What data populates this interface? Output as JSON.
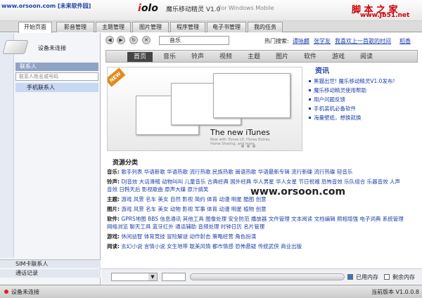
{
  "titlebar": {
    "site_url": "www.orsoon.com [未来软件园]",
    "logo_i": "i",
    "logo_olo": "olo",
    "app_name": "魔乐移动精灵 V1.0",
    "platform": "For Windows Mobile",
    "site_logo": "脚 本 之 家",
    "site_sub": "www.Jb51.net"
  },
  "tabs": [
    "开始页面",
    "影音管理",
    "主题管理",
    "图片管理",
    "程序管理",
    "电子书管理",
    "我的任务"
  ],
  "left": {
    "device_status": "设备未连接",
    "contacts_header": "联系人",
    "search_placeholder": "联系人姓名或号码",
    "contacts_item": "手机联系人",
    "bottom_sim": "SIM卡联系人",
    "bottom_calls": "通话记录"
  },
  "nav": {
    "back": "◀",
    "forward": "▶",
    "refresh": "↻",
    "stop": "✕",
    "address": "音乐",
    "hot_label": "热门搜索:",
    "hot_links": [
      "谭咏麟",
      "张学友",
      "我喜欢上一首歌的时间",
      "稻香"
    ]
  },
  "categories": [
    "首页",
    "音乐",
    "铃声",
    "视频",
    "主题",
    "图片",
    "软件",
    "游戏",
    "阅读"
  ],
  "banner": {
    "badge": "NEW",
    "headline": "The new iTunes",
    "sub": "Now with iTunes LP, iTunes Extras, Home Sharing, and more."
  },
  "info": {
    "title": "资讯",
    "items": [
      "黑猫出世! 魔乐移动精灵V1.0发布!",
      "魔乐移动精灵使用帮助",
      "用户问题反馈",
      "手机装机必备软件",
      "海量壁纸，想换就换"
    ]
  },
  "resources": {
    "title": "资源分类",
    "rows": [
      {
        "label": "音乐:",
        "links": "歌手列表 华语新歌 华语热歌 流行热歌 民族热歌 闽语热歌 华语最新专辑 流行新碟 流行热碟 轻音乐"
      },
      {
        "label": "铃声:",
        "links": "DJ音效 大话滑稽 动物叫叫 儿童音乐 古典经典 国外经典 华人男星 华人女星 节日祝福 恐怖音效 乐队组合 乐器音效 人声音效 日韩天后 影视歌曲 原声大碟 原汁搞笑"
      },
      {
        "label": "主题:",
        "links": "游戏 风景 名车 美女 自然 影视 简约 体育 动漫 明星 酷图 创意"
      },
      {
        "label": "图片:",
        "links": "游戏 风景 名车 美女 动物 影视 军事 体育 动漫 明星 植物 创意"
      },
      {
        "label": "软件:",
        "links": "GPRS地图 BBS 信息通讯 其他工具 图像处理 安全防范 播放器 文件管理 文本阅读 文档编辑 照相增强 电子词典 系统管理 网络浏览 聊天工具 蓝牙红外 通话辅助 音频处理 时钟日历 名片管理"
      },
      {
        "label": "游戏:",
        "links": "休闲益智 体育竞技 冒险解谜 动作射击 策略经营 角色扮演"
      },
      {
        "label": "阅读:",
        "links": "玄幻小说 言情小说 女生地带 耽美风情 都市情感 恐怖悬疑 传统武侠 商业出版"
      }
    ]
  },
  "bottom": {
    "used_label": "已用内存",
    "free_label": "剩余内存"
  },
  "status": {
    "left": "设备未连接",
    "right": "当前版本 V1.0.0.8"
  },
  "watermark": "www.orsoon.com"
}
